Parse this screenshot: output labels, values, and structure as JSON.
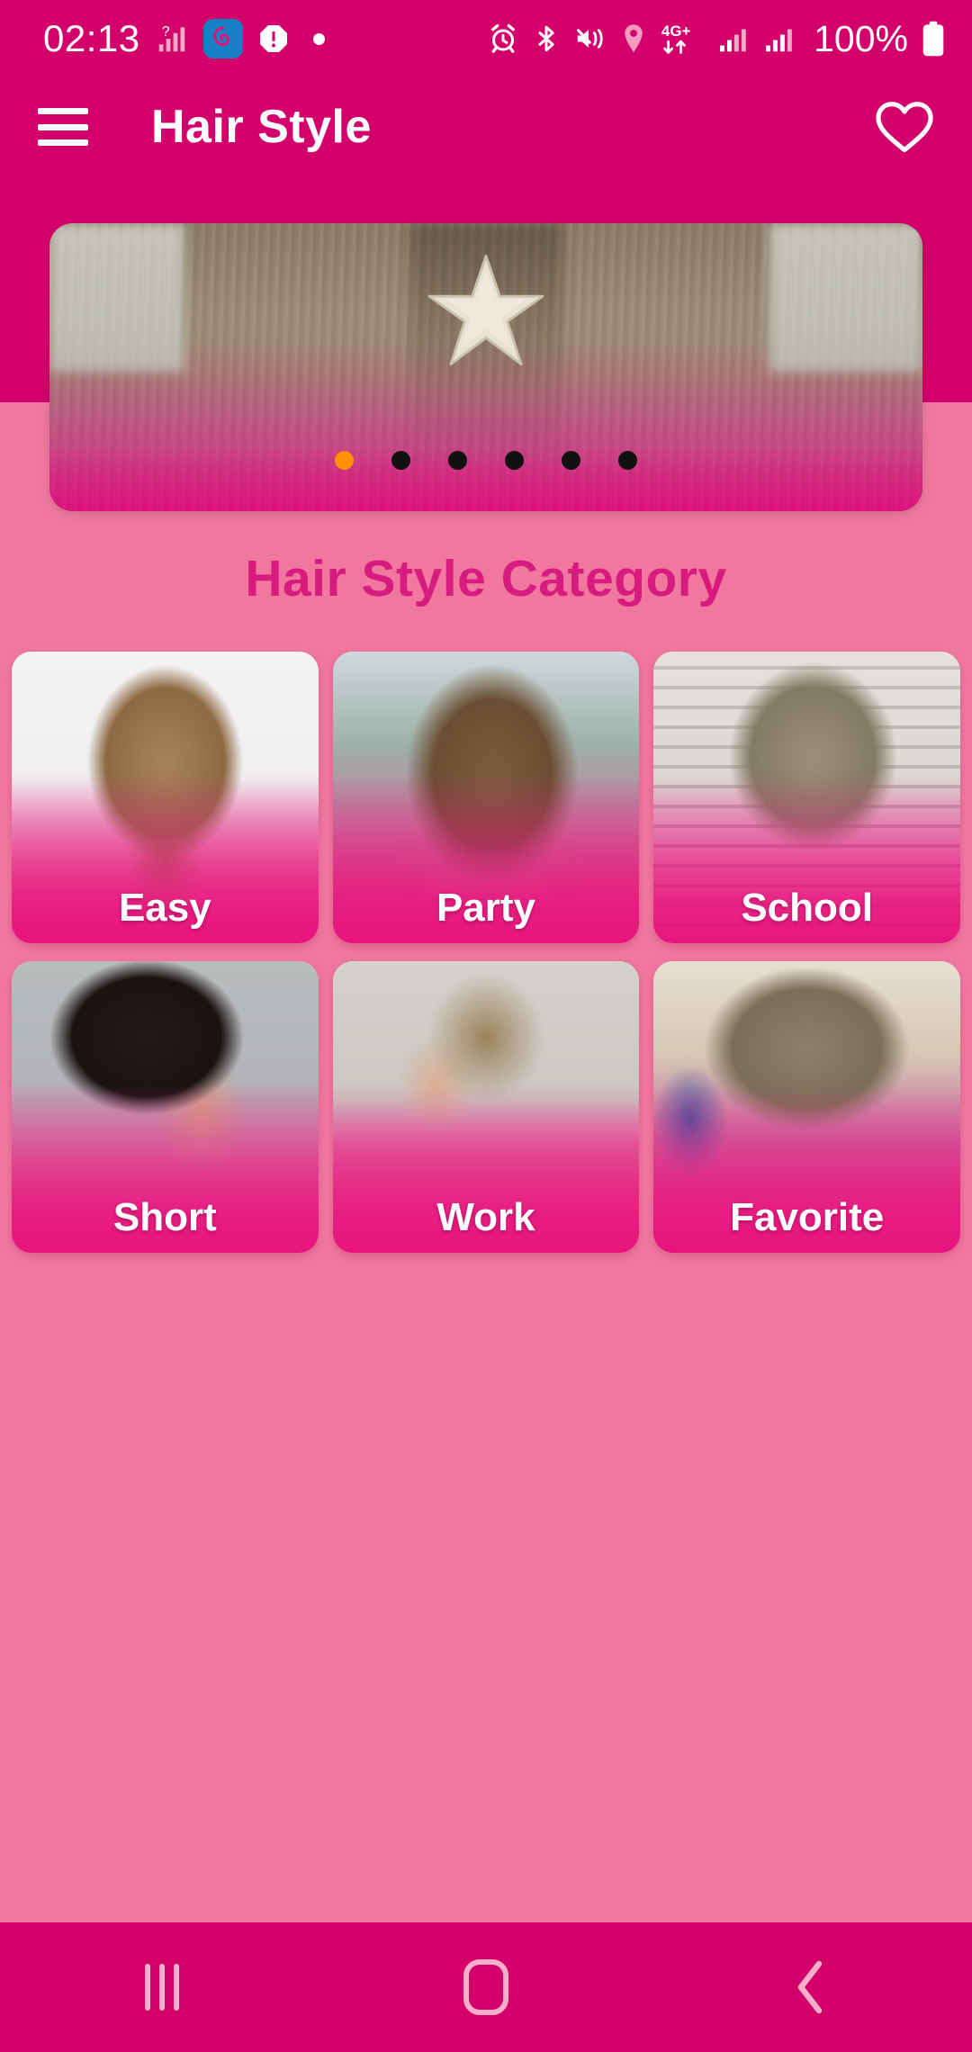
{
  "status_bar": {
    "time": "02:13",
    "battery_percent": "100%",
    "network_label": "4G+",
    "left_icons": [
      "signal-unknown-icon",
      "app-notification-icon",
      "error-notification-icon",
      "dot-notification-icon"
    ],
    "right_icons": [
      "alarm-icon",
      "bluetooth-icon",
      "vibrate-mute-icon",
      "location-icon",
      "network-4g-plus-icon",
      "signal-sim1-icon",
      "signal-sim2-icon",
      "battery-icon"
    ]
  },
  "app_bar": {
    "title": "Hair Style",
    "menu_icon": "hamburger-menu-icon",
    "favorite_icon": "heart-outline-icon"
  },
  "banner": {
    "alt": "Starfish hair clip hairstyle",
    "total_slides": 6,
    "active_slide": 1,
    "active_dot_color": "#FF9100",
    "inactive_dot_color": "#111111"
  },
  "section": {
    "title": "Hair Style Category",
    "title_color": "#D81B7E"
  },
  "categories": [
    {
      "label": "Easy",
      "art": "art-easy"
    },
    {
      "label": "Party",
      "art": "art-party"
    },
    {
      "label": "School",
      "art": "art-school"
    },
    {
      "label": "Short",
      "art": "art-short"
    },
    {
      "label": "Work",
      "art": "art-work"
    },
    {
      "label": "Favorite",
      "art": "art-favorite"
    }
  ],
  "nav_bar": {
    "recents_label": "recent-apps",
    "home_label": "home",
    "back_label": "back"
  },
  "theme": {
    "primary": "#D3006B",
    "background": "#F0789F",
    "accent": "#FF9100",
    "on_primary": "#FFFFFF"
  }
}
